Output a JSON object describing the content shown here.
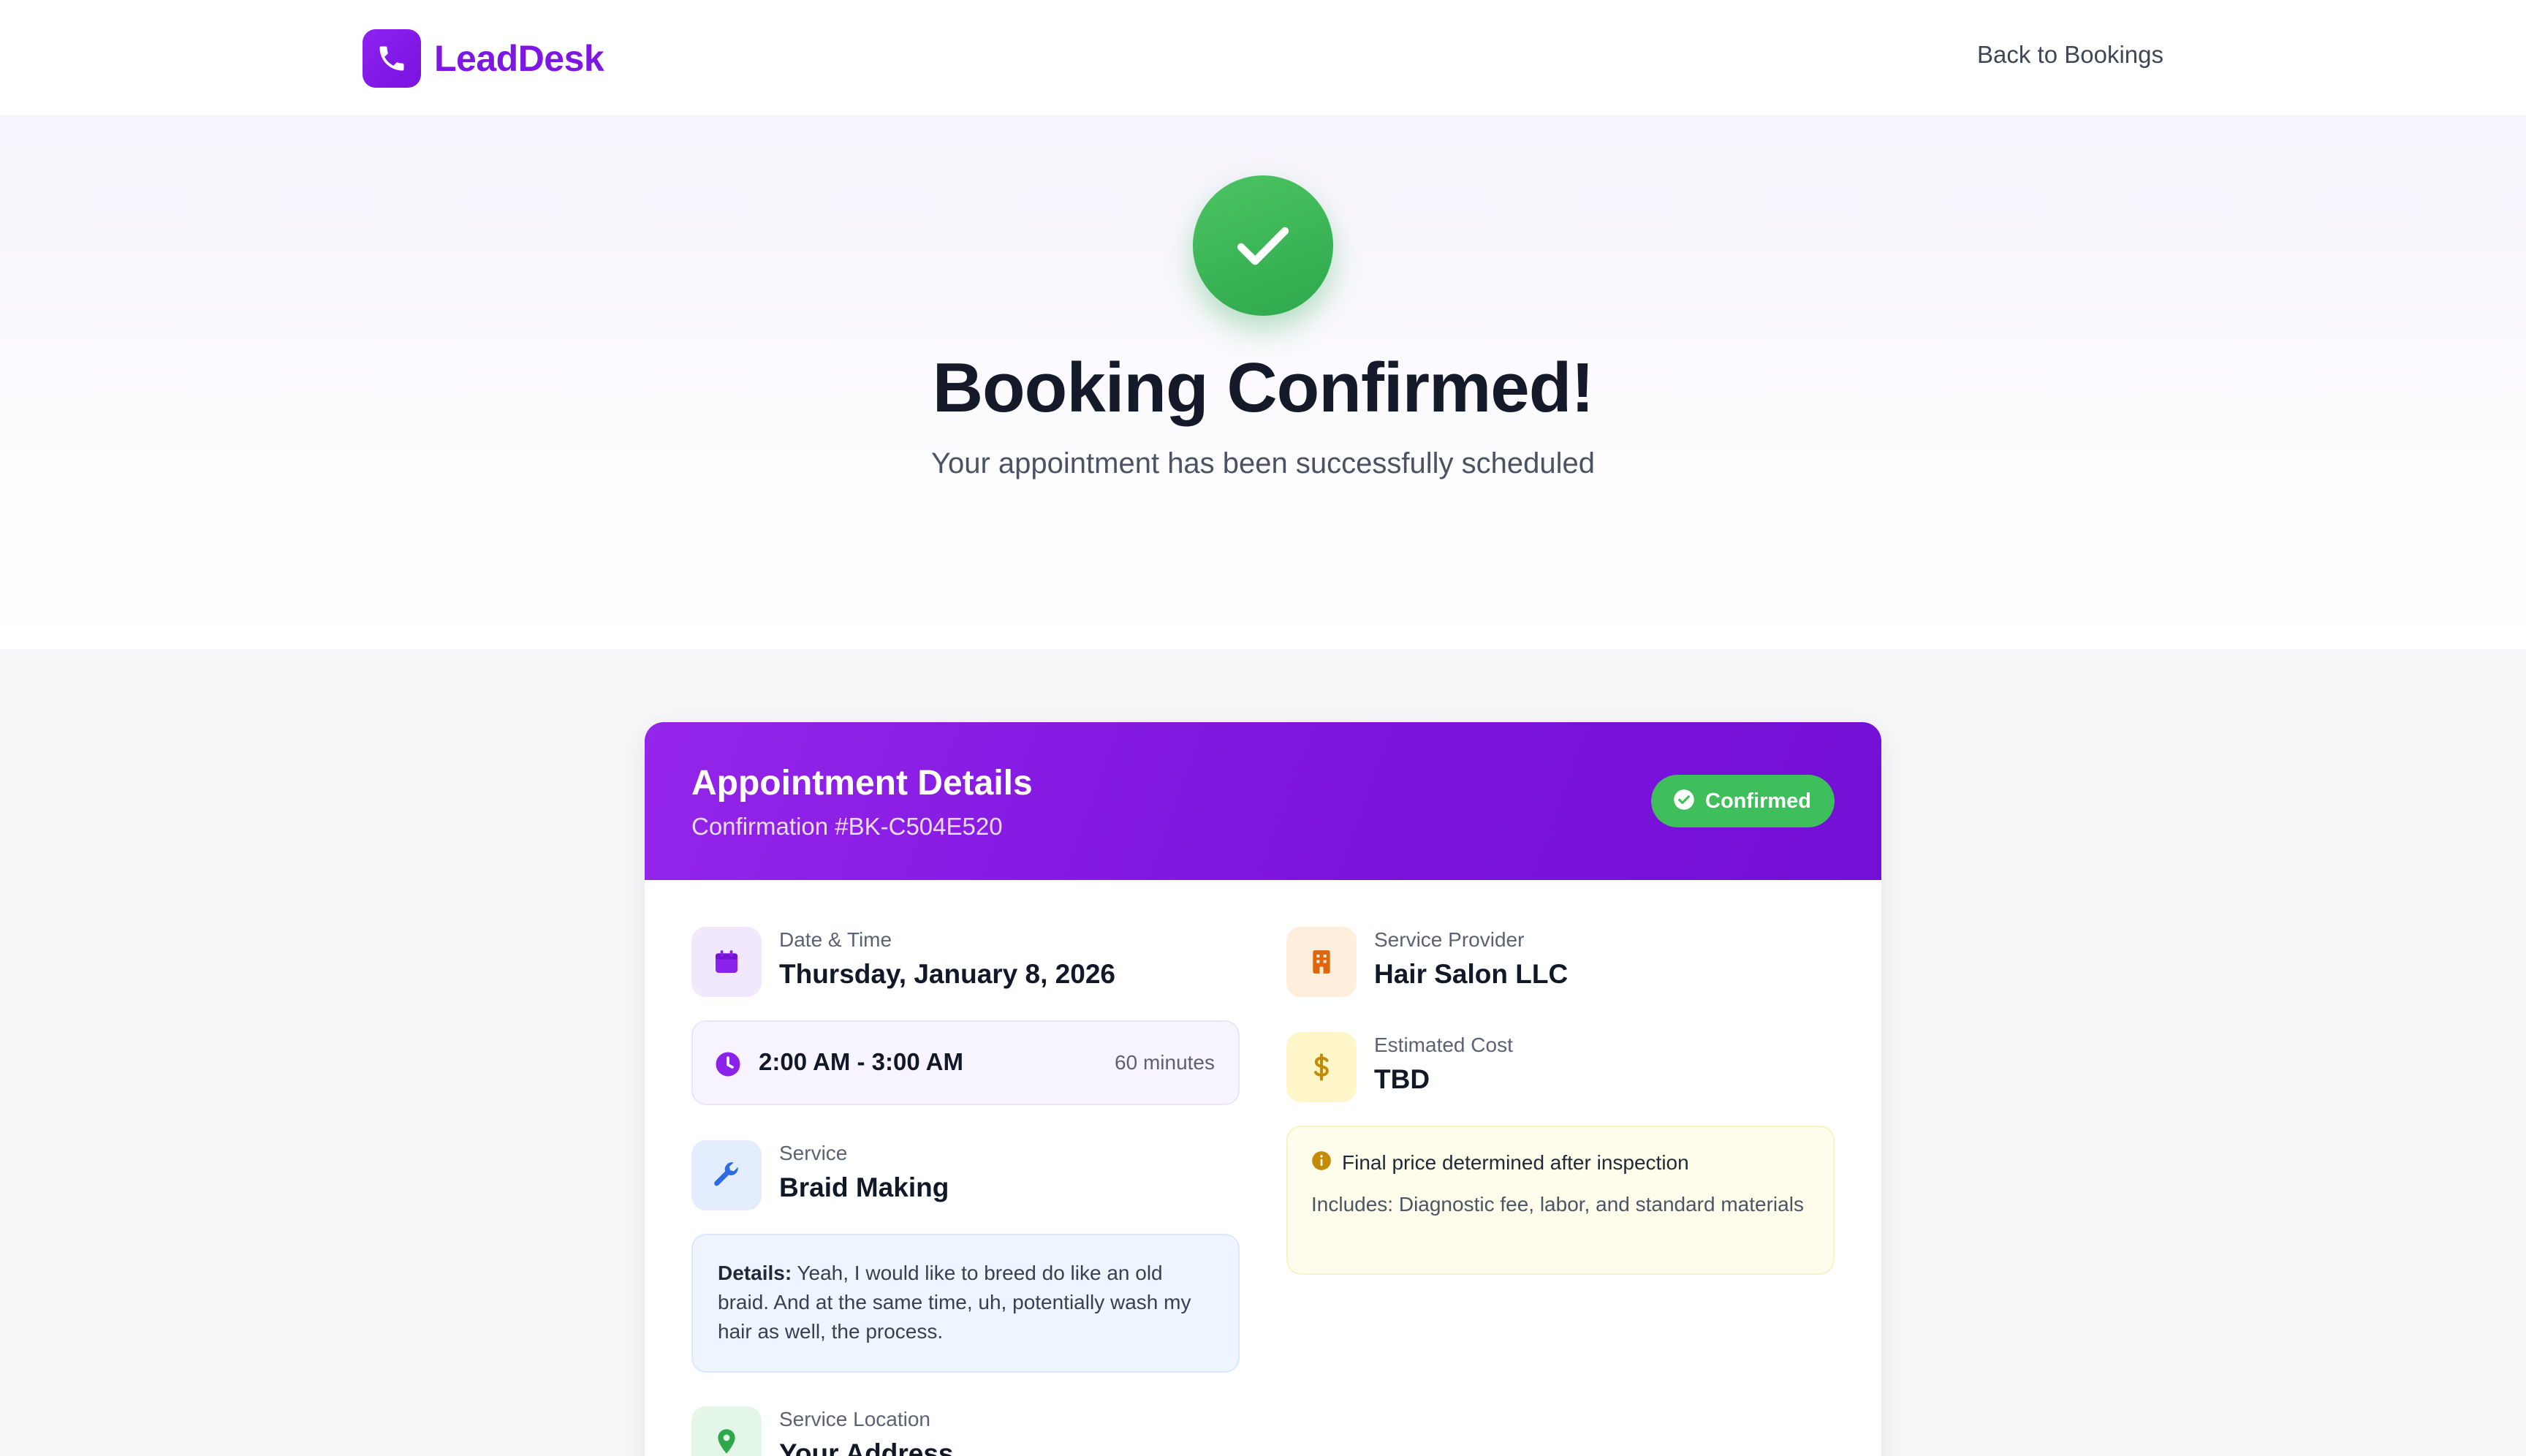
{
  "header": {
    "brand": "LeadDesk",
    "back_link": "Back to Bookings"
  },
  "hero": {
    "title": "Booking Confirmed!",
    "subtitle": "Your appointment has been successfully scheduled"
  },
  "card": {
    "title": "Appointment Details",
    "confirmation": "Confirmation #BK-C504E520",
    "status_badge": "Confirmed",
    "date_label": "Date & Time",
    "date_value": "Thursday, January 8, 2026",
    "time_range": "2:00 AM - 3:00 AM",
    "duration": "60 minutes",
    "service_label": "Service",
    "service_value": "Braid Making",
    "details_label": "Details:",
    "details_text": " Yeah, I would like to breed do like an old braid. And at the same time, uh, potentially wash my hair as well, the process.",
    "location_label": "Service Location",
    "location_value": "Your Address",
    "provider_label": "Service Provider",
    "provider_value": "Hair Salon LLC",
    "cost_label": "Estimated Cost",
    "cost_value": "TBD",
    "note_title": "Final price determined after inspection",
    "note_body": "Includes: Diagnostic fee, labor, and standard materials"
  },
  "colors": {
    "brand_purple": "#7e17e3",
    "success_green": "#3fbe5c",
    "header_gradient_start": "#9525ea",
    "header_gradient_end": "#7410d6"
  },
  "icons": {
    "logo": "phone-icon",
    "hero": "checkmark-icon",
    "badge": "check-circle-icon",
    "date": "calendar-icon",
    "time": "clock-icon",
    "service": "wrench-icon",
    "location": "map-pin-icon",
    "provider": "building-icon",
    "cost": "dollar-icon",
    "note": "info-icon"
  }
}
